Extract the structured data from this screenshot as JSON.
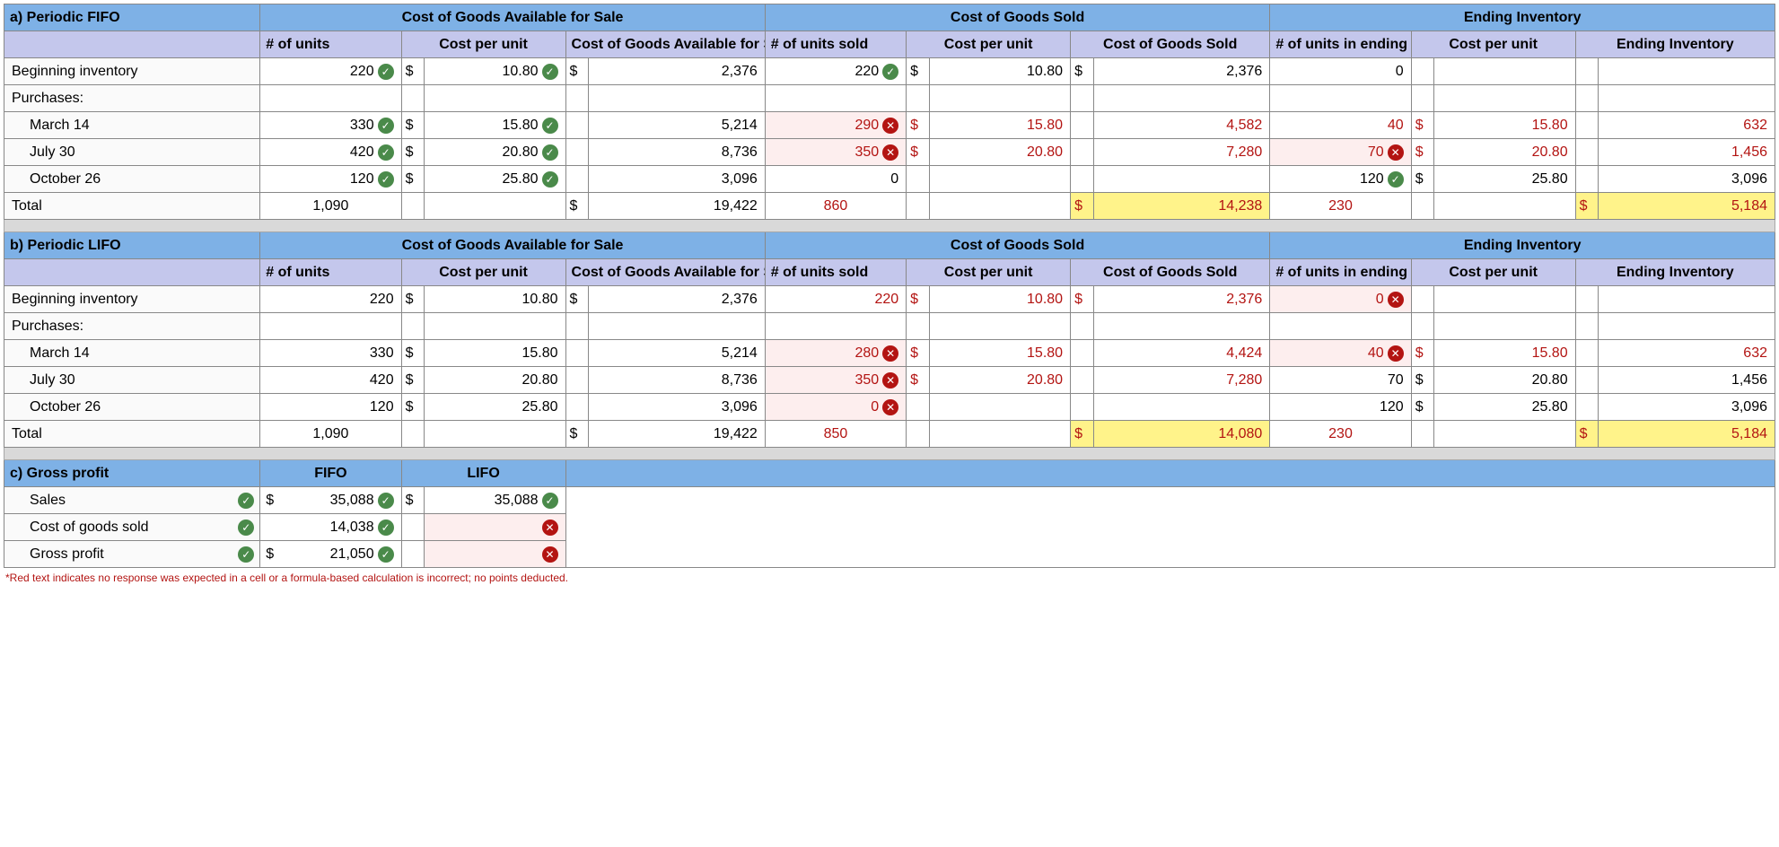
{
  "fifo": {
    "title": "a) Periodic FIFO",
    "group_headers": [
      "Cost of Goods Available for Sale",
      "Cost of Goods Sold",
      "Ending Inventory"
    ],
    "col_headers": [
      "# of units",
      "Cost per unit",
      "Cost of Goods Available for Sale",
      "# of units sold",
      "Cost per unit",
      "Cost of Goods Sold",
      "# of units in ending inventory",
      "Cost per unit",
      "Ending Inventory"
    ],
    "rows": {
      "beg": {
        "label": "Beginning inventory",
        "units": "220",
        "cpu": "10.80",
        "cogas": "2,376",
        "sold": "220",
        "cpu2": "10.80",
        "cogs": "2,376",
        "endu": "0"
      },
      "purch": {
        "label": "Purchases:"
      },
      "mar": {
        "label": "March 14",
        "units": "330",
        "cpu": "15.80",
        "cogas": "5,214",
        "sold": "290",
        "cpu2": "15.80",
        "cogs": "4,582",
        "endu": "40",
        "cpu3": "15.80",
        "endv": "632"
      },
      "jul": {
        "label": "July 30",
        "units": "420",
        "cpu": "20.80",
        "cogas": "8,736",
        "sold": "350",
        "cpu2": "20.80",
        "cogs": "7,280",
        "endu": "70",
        "cpu3": "20.80",
        "endv": "1,456"
      },
      "oct": {
        "label": "October 26",
        "units": "120",
        "cpu": "25.80",
        "cogas": "3,096",
        "sold": "0",
        "endu": "120",
        "cpu3": "25.80",
        "endv": "3,096"
      },
      "tot": {
        "label": "Total",
        "units": "1,090",
        "cogas": "19,422",
        "sold": "860",
        "cogs": "14,238",
        "endu": "230",
        "endv": "5,184"
      }
    }
  },
  "lifo": {
    "title": "b) Periodic LIFO",
    "group_headers": [
      "Cost of Goods Available for Sale",
      "Cost of Goods Sold",
      "Ending Inventory"
    ],
    "col_headers": [
      "# of units",
      "Cost per unit",
      "Cost of Goods Available for Sale",
      "# of units sold",
      "Cost per unit",
      "Cost of Goods Sold",
      "# of units in ending inventory",
      "Cost per unit",
      "Ending Inventory"
    ],
    "rows": {
      "beg": {
        "label": "Beginning inventory",
        "units": "220",
        "cpu": "10.80",
        "cogas": "2,376",
        "sold": "220",
        "cpu2": "10.80",
        "cogs": "2,376",
        "endu": "0"
      },
      "purch": {
        "label": "Purchases:"
      },
      "mar": {
        "label": "March 14",
        "units": "330",
        "cpu": "15.80",
        "cogas": "5,214",
        "sold": "280",
        "cpu2": "15.80",
        "cogs": "4,424",
        "endu": "40",
        "cpu3": "15.80",
        "endv": "632"
      },
      "jul": {
        "label": "July 30",
        "units": "420",
        "cpu": "20.80",
        "cogas": "8,736",
        "sold": "350",
        "cpu2": "20.80",
        "cogs": "7,280",
        "endu": "70",
        "cpu3": "20.80",
        "endv": "1,456"
      },
      "oct": {
        "label": "October 26",
        "units": "120",
        "cpu": "25.80",
        "cogas": "3,096",
        "sold": "0",
        "endu": "120",
        "cpu3": "25.80",
        "endv": "3,096"
      },
      "tot": {
        "label": "Total",
        "units": "1,090",
        "cogas": "19,422",
        "sold": "850",
        "cogs": "14,080",
        "endu": "230",
        "endv": "5,184"
      }
    }
  },
  "gp": {
    "title": "c) Gross profit",
    "headers": [
      "FIFO",
      "LIFO"
    ],
    "rows": {
      "sales": {
        "label": "Sales",
        "fifo": "35,088",
        "lifo": "35,088"
      },
      "cogs": {
        "label": "Cost of goods sold",
        "fifo": "14,038"
      },
      "gp": {
        "label": "Gross profit",
        "fifo": "21,050"
      }
    }
  },
  "sym": {
    "dollar": "$",
    "check": "✓",
    "cross": "✕"
  },
  "footnote": "*Red text indicates no response was expected in a cell or a formula-based calculation is incorrect; no points deducted."
}
